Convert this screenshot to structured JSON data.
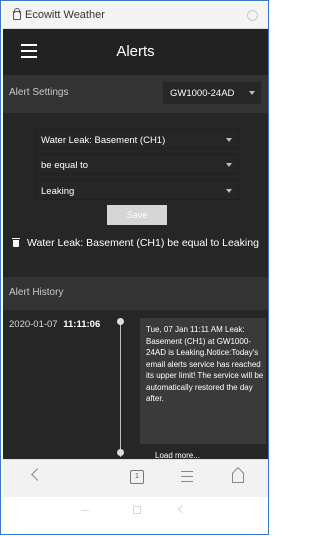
{
  "browser": {
    "title": "Ecowitt Weather"
  },
  "header": {
    "title": "Alerts"
  },
  "alert_settings": {
    "label": "Alert Settings",
    "device": "GW1000-24AD"
  },
  "form": {
    "sensor": "Water Leak: Basement (CH1)",
    "condition": "be equal to",
    "value": "Leaking",
    "save_label": "Save"
  },
  "summary": "Water Leak: Basement (CH1) be equal to Leaking",
  "history": {
    "label": "Alert History",
    "items": [
      {
        "date": "2020-01-07",
        "time": "11:11:06",
        "message": "Tue, 07 Jan 11:11 AM Leak: Basement (CH1) at GW1000-24AD is Leaking.Notice:Today's email alerts service has reached its upper limit! The service will be automatically restored the day after."
      }
    ],
    "load_more": "Load more..."
  },
  "navbar": {
    "tabs_count": "1"
  }
}
